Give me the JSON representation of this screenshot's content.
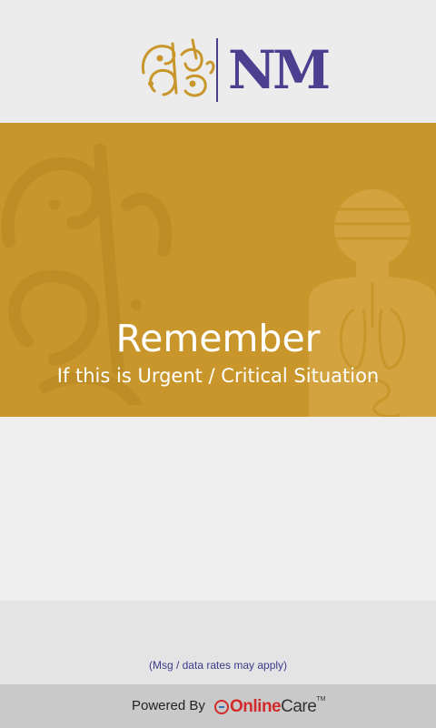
{
  "header": {
    "logo_monogram": "NM",
    "logo_calligraphy_icon": "arabic-calligraphy-logo-icon",
    "brand_colors": {
      "monogram": "#4c3f8f",
      "calligraphy": "#c8962a"
    }
  },
  "banner": {
    "title": "Remember",
    "subtitle": "If this is Urgent / Critical Situation",
    "background_color": "#c8962a",
    "decor_left_icon": "arabic-calligraphy-watermark-icon",
    "decor_right_icon": "patient-anatomy-icon"
  },
  "footer": {
    "rates_note": "(Msg / data  rates may apply)",
    "powered_by": "Powered By",
    "brand_online": "Online",
    "brand_care": "Care",
    "brand_tm": "TM",
    "brand_icon": "globe-icon"
  }
}
